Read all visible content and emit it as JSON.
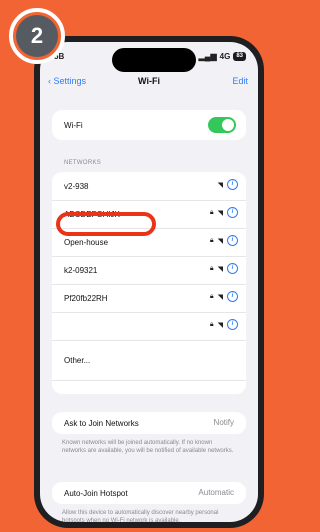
{
  "step": {
    "number": "2"
  },
  "status_bar": {
    "carrier": "5B",
    "signal": "4G",
    "battery": "83"
  },
  "nav": {
    "back": "‹ Settings",
    "title": "Wi-Fi",
    "edit": "Edit"
  },
  "wifi": {
    "label": "Wi-Fi",
    "enabled": true
  },
  "networks_header": "NETWORKS",
  "networks": [
    {
      "name": "v2-938",
      "locked": false,
      "highlighted": false
    },
    {
      "name": "ABCDEFGHIJK",
      "locked": true,
      "highlighted": true
    },
    {
      "name": "Open-house",
      "locked": true,
      "highlighted": false
    },
    {
      "name": "k2-09321",
      "locked": true,
      "highlighted": false
    },
    {
      "name": "Pf20fb22RH",
      "locked": true,
      "highlighted": false
    },
    {
      "name": "",
      "locked": true,
      "highlighted": false
    },
    {
      "name": "Other...",
      "locked": false,
      "highlighted": false
    }
  ],
  "ask_join": {
    "label": "Ask to Join Networks",
    "value": "Notify",
    "description": "Known networks will be joined automatically. If no known networks are available, you will be notified of available networks."
  },
  "auto_join": {
    "label": "Auto-Join Hotspot",
    "value": "Automatic",
    "description": "Allow this device to automatically discover nearby personal hotspots when no Wi-Fi network is available."
  },
  "colors": {
    "accent": "#2f7df6",
    "toggle_on": "#34c759",
    "highlight": "#ea3417",
    "background": "#f26433"
  }
}
